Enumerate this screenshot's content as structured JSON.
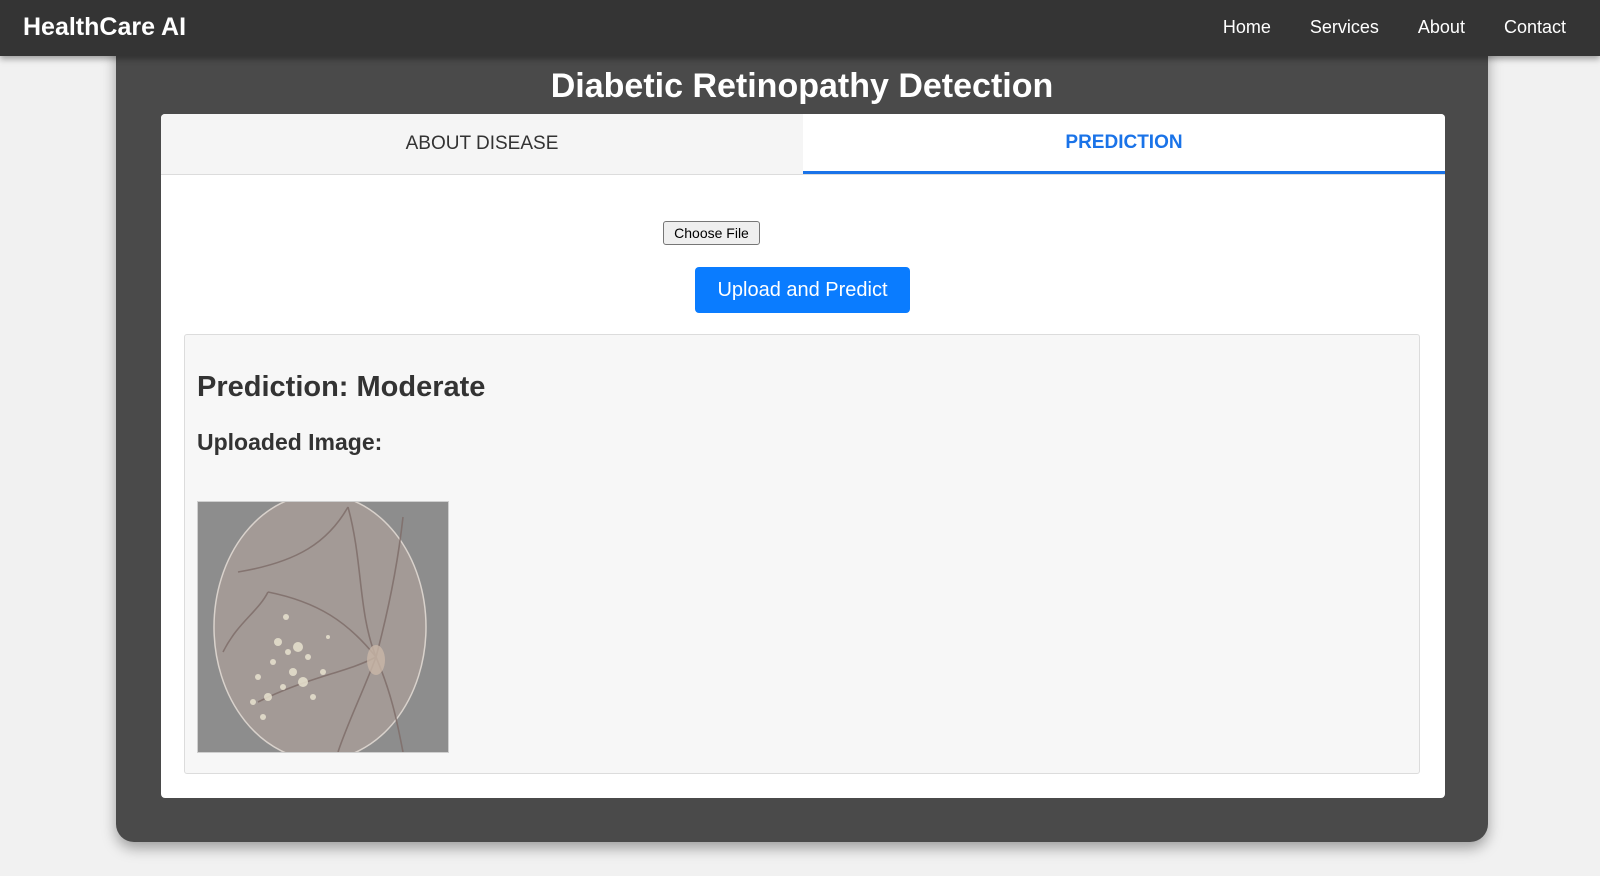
{
  "navbar": {
    "brand": "HealthCare AI",
    "links": [
      "Home",
      "Services",
      "About",
      "Contact"
    ]
  },
  "page": {
    "title": "Diabetic Retinopathy Detection"
  },
  "tabs": {
    "about": "ABOUT DISEASE",
    "prediction": "PREDICTION",
    "active": "PREDICTION"
  },
  "form": {
    "choose_file_label": "Choose File",
    "upload_button": "Upload and Predict"
  },
  "result": {
    "prediction": "Prediction: Moderate",
    "uploaded_label": "Uploaded Image:"
  },
  "colors": {
    "accent": "#0a7cff",
    "navbar": "#343434",
    "card": "#4a4a4a"
  }
}
